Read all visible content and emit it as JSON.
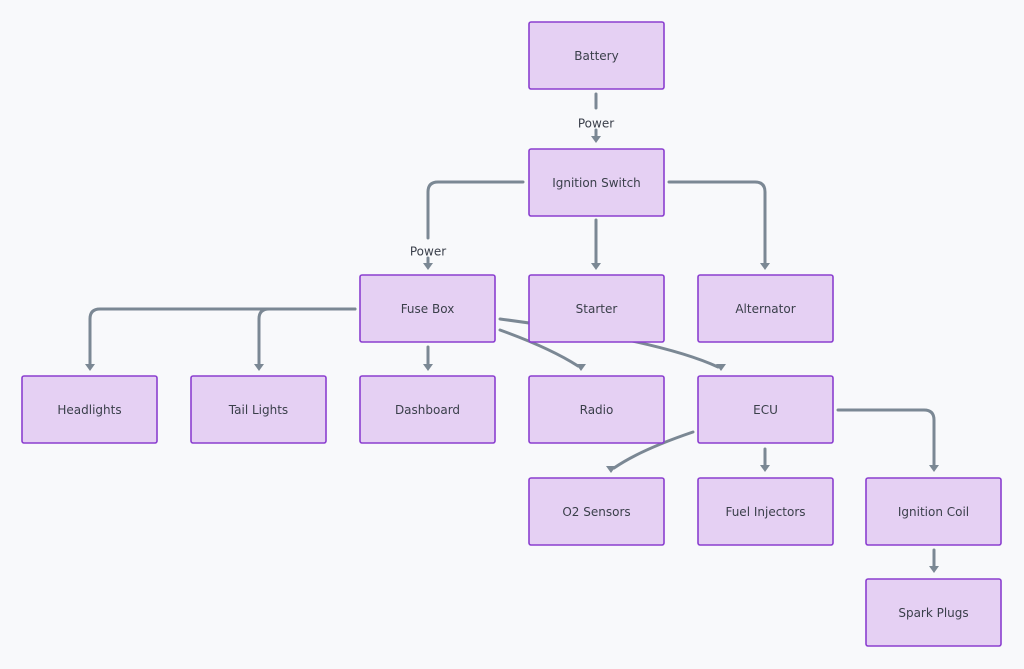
{
  "colors": {
    "node_fill": "#e5d0f3",
    "node_border": "#8b3fd0",
    "edge": "#7b8894",
    "background": "#f8f9fb",
    "text": "#3a3f4a"
  },
  "nodes": [
    {
      "id": "battery",
      "label": "Battery"
    },
    {
      "id": "ignition_switch",
      "label": "Ignition Switch"
    },
    {
      "id": "fuse_box",
      "label": "Fuse Box"
    },
    {
      "id": "starter",
      "label": "Starter"
    },
    {
      "id": "alternator",
      "label": "Alternator"
    },
    {
      "id": "headlights",
      "label": "Headlights"
    },
    {
      "id": "tail_lights",
      "label": "Tail Lights"
    },
    {
      "id": "dashboard",
      "label": "Dashboard"
    },
    {
      "id": "radio",
      "label": "Radio"
    },
    {
      "id": "ecu",
      "label": "ECU"
    },
    {
      "id": "o2_sensors",
      "label": "O2 Sensors"
    },
    {
      "id": "fuel_injectors",
      "label": "Fuel Injectors"
    },
    {
      "id": "ignition_coil",
      "label": "Ignition Coil"
    },
    {
      "id": "spark_plugs",
      "label": "Spark Plugs"
    }
  ],
  "edges": [
    {
      "from": "battery",
      "to": "ignition_switch",
      "label": "Power"
    },
    {
      "from": "ignition_switch",
      "to": "fuse_box",
      "label": "Power"
    },
    {
      "from": "ignition_switch",
      "to": "starter"
    },
    {
      "from": "ignition_switch",
      "to": "alternator"
    },
    {
      "from": "fuse_box",
      "to": "headlights"
    },
    {
      "from": "fuse_box",
      "to": "tail_lights"
    },
    {
      "from": "fuse_box",
      "to": "dashboard"
    },
    {
      "from": "fuse_box",
      "to": "radio"
    },
    {
      "from": "fuse_box",
      "to": "ecu"
    },
    {
      "from": "ecu",
      "to": "o2_sensors"
    },
    {
      "from": "ecu",
      "to": "fuel_injectors"
    },
    {
      "from": "ecu",
      "to": "ignition_coil"
    },
    {
      "from": "ignition_coil",
      "to": "spark_plugs"
    }
  ]
}
